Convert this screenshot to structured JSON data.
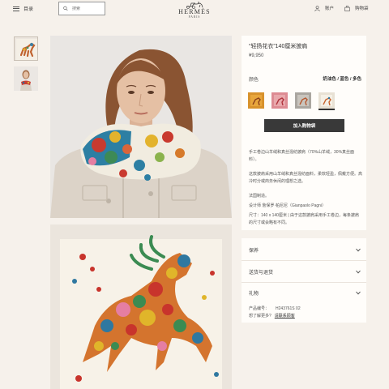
{
  "header": {
    "menu_label": "目录",
    "search_placeholder": "搜索",
    "brand": "HERMÈS",
    "city": "PARIS",
    "account_label": "账户",
    "cart_label": "购物袋"
  },
  "product": {
    "title": "“轻扬花衣”140厘米披肩",
    "price": "¥9,950",
    "color_label": "颜色",
    "color_value": "奶油色 / 蓝色 / 多色",
    "swatches": [
      {
        "name": "orange-swatch",
        "color": "#d8922c"
      },
      {
        "name": "pink-swatch",
        "color": "#e39aa0"
      },
      {
        "name": "grey-swatch",
        "color": "#b6b3ad"
      },
      {
        "name": "cream-swatch",
        "color": "#efe9dd"
      }
    ],
    "add_to_cart": "加入购物袋",
    "description": [
      "手工卷边山羊绒和真丝混纺披肩（70%山羊绒，30%真丝面料）。",
      "这款披肩采用山羊绒和真丝混纺面料，柔软轻盈，佩戴方便。高冷时分或商务休闲的理想之选。",
      "法国制造。",
      "设计师 詹保罗·帕尼尼（Gianpaolo Pagni）",
      "尺寸：140 x 140厘米 | 由于这款披肩采用手工卷边，每条披肩的尺寸或会略有不同。"
    ],
    "accordion": [
      "保养",
      "送货与退货",
      "礼物"
    ],
    "product_code_label": "产品编号：",
    "product_code": "H243761S 02",
    "help_label": "想了解更多?",
    "contact_label": "请联系顾客"
  }
}
